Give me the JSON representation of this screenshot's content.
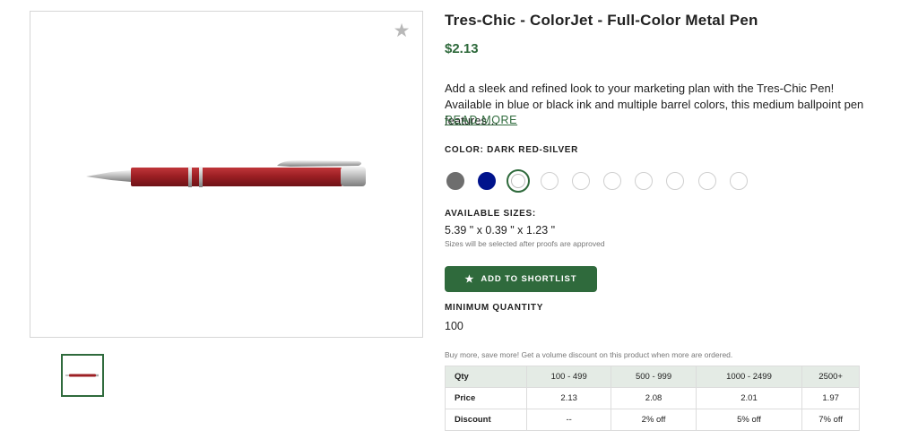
{
  "product": {
    "title": "Tres-Chic - ColorJet - Full-Color Metal Pen",
    "price": "$2.13",
    "description": "Add a sleek and refined look to your marketing plan with the Tres-Chic Pen! Available in blue or black ink and multiple barrel colors, this medium ballpoint pen features…",
    "read_more": "READ MORE"
  },
  "image": {
    "favorite_icon": "star-icon",
    "favorite_glyph": "★"
  },
  "color": {
    "label": "COLOR: DARK RED-SILVER",
    "swatches": [
      {
        "name": "gray",
        "hex": "#6e6e6e"
      },
      {
        "name": "blue",
        "hex": "#00138c"
      },
      {
        "name": "dark-red-silver",
        "hex": "#ffffff",
        "selected": true
      },
      {
        "name": "white-1",
        "hex": "#ffffff"
      },
      {
        "name": "white-2",
        "hex": "#ffffff"
      },
      {
        "name": "white-3",
        "hex": "#ffffff"
      },
      {
        "name": "white-4",
        "hex": "#ffffff"
      },
      {
        "name": "white-5",
        "hex": "#ffffff"
      },
      {
        "name": "white-6",
        "hex": "#ffffff"
      },
      {
        "name": "white-7",
        "hex": "#ffffff"
      }
    ]
  },
  "sizes": {
    "label": "AVAILABLE SIZES:",
    "value": "5.39 \" x 0.39 \" x 1.23 \"",
    "note": "Sizes will be selected after proofs are approved"
  },
  "shortlist": {
    "label": "ADD TO SHORTLIST",
    "icon": "star-icon",
    "glyph": "★"
  },
  "minimum": {
    "label": "MINIMUM QUANTITY",
    "value": "100"
  },
  "volume_note": "Buy more, save more! Get a volume discount on this product when more are ordered.",
  "pricing_table": {
    "header": [
      "Qty",
      "100 - 499",
      "500 - 999",
      "1000 - 2499",
      "2500+"
    ],
    "rows": [
      [
        "Price",
        "2.13",
        "2.08",
        "2.01",
        "1.97"
      ],
      [
        "Discount",
        "--",
        "2% off",
        "5% off",
        "7% off"
      ]
    ]
  },
  "colors": {
    "accent": "#2f6a3c",
    "table_header_bg": "#e4ebe5",
    "pen_body": "#9c1f24"
  }
}
